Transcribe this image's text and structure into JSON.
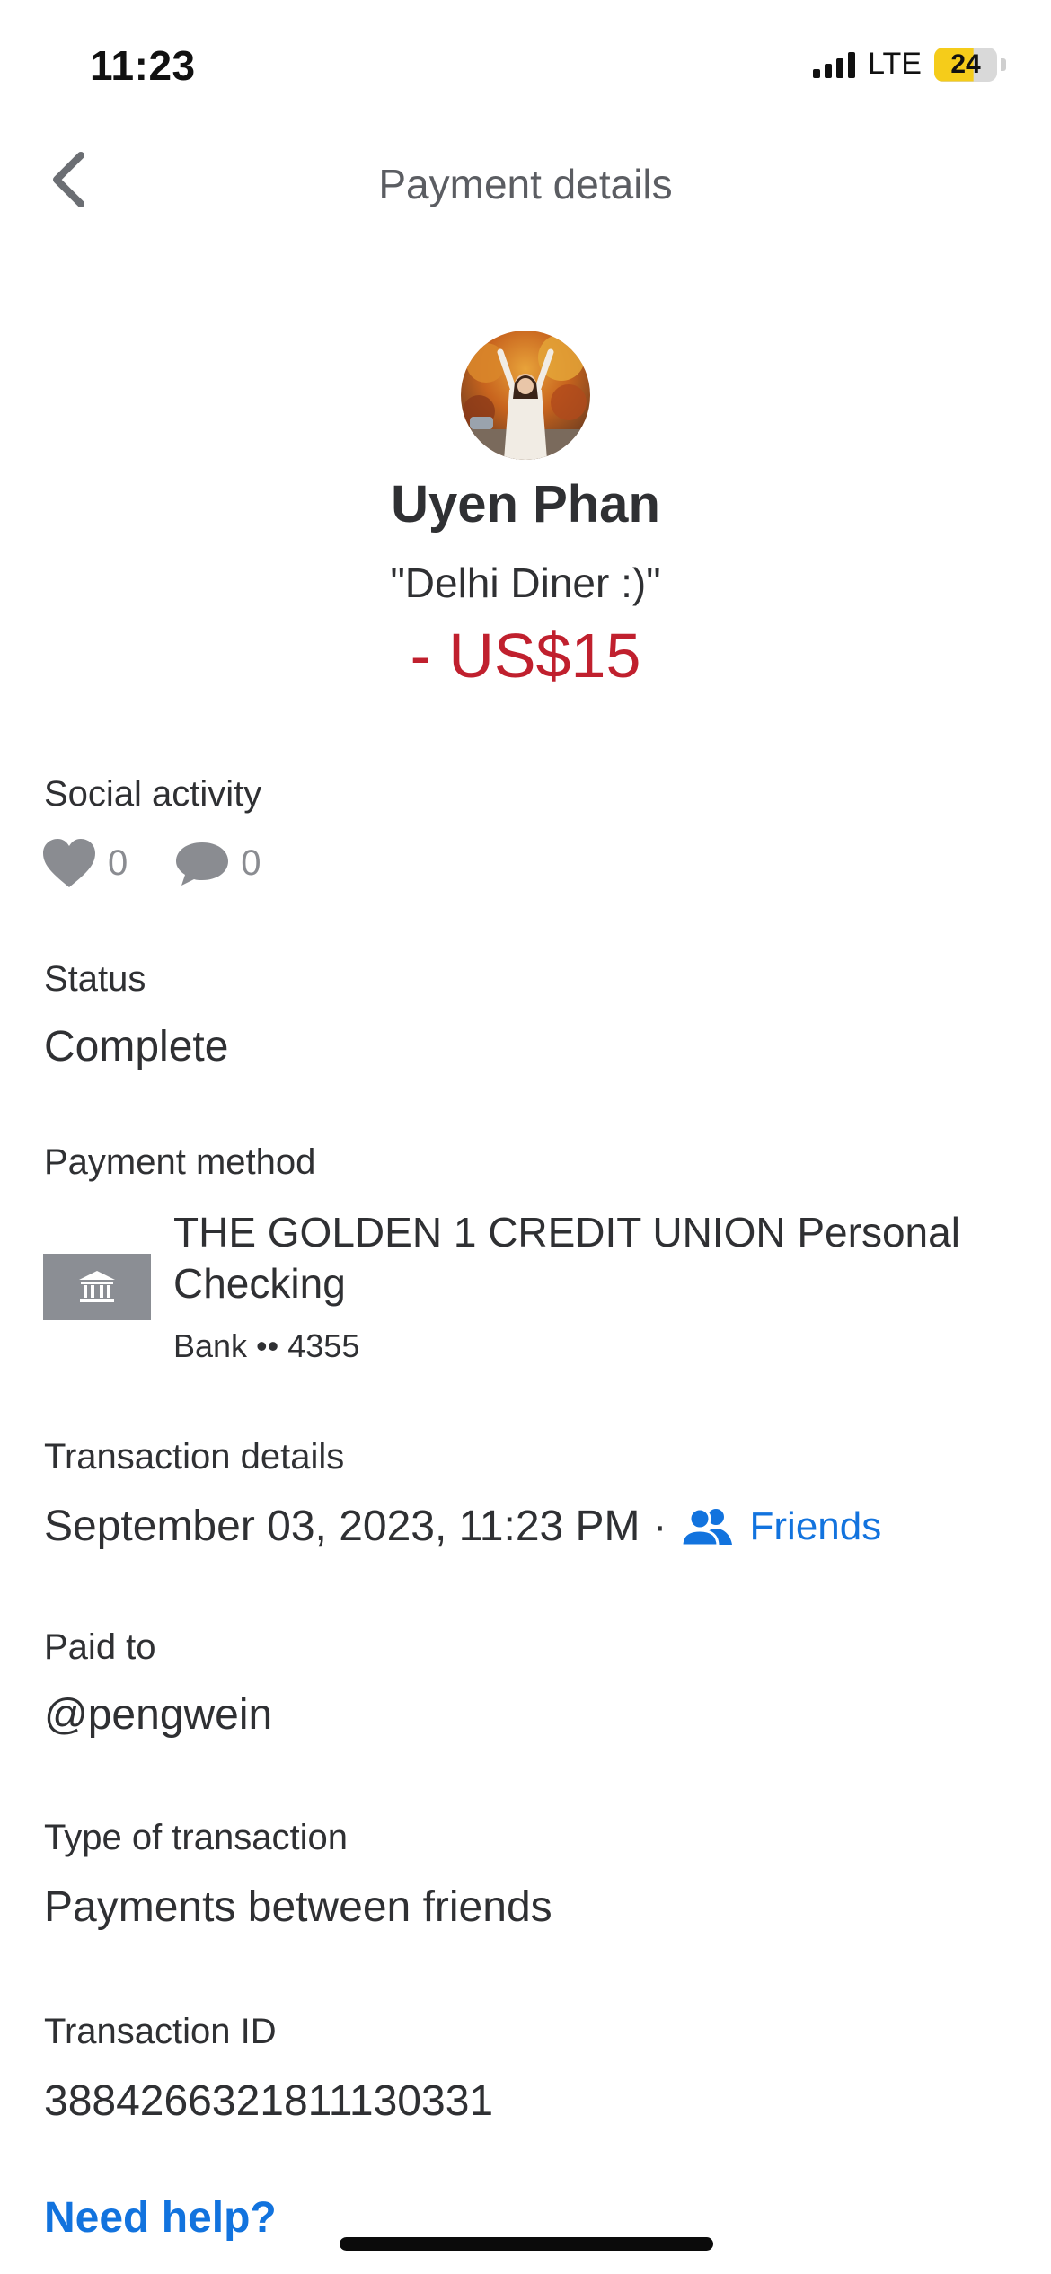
{
  "status_bar": {
    "time": "11:23",
    "network": "LTE",
    "battery": "24",
    "battery_level_percent": 24,
    "battery_color": "#f5cc1a"
  },
  "header": {
    "back_icon": "chevron-left-icon",
    "title": "Payment details"
  },
  "profile": {
    "name": "Uyen Phan",
    "note": "\"Delhi Diner :)\"",
    "amount": "- US$15",
    "amount_color": "#c0202e"
  },
  "social": {
    "label": "Social activity",
    "likes": "0",
    "comments": "0",
    "like_icon": "heart-icon",
    "comment_icon": "comment-bubble-icon"
  },
  "status": {
    "label": "Status",
    "value": "Complete"
  },
  "payment_method": {
    "label": "Payment method",
    "icon": "bank-icon",
    "bank_name": "THE GOLDEN 1 CREDIT UNION Personal Checking",
    "account": "Bank •• 4355"
  },
  "transaction_details": {
    "label": "Transaction details",
    "datetime": "September 03, 2023, 11:23 PM",
    "separator": "·",
    "audience_icon": "friends-icon",
    "audience": "Friends",
    "link_color": "#1273de"
  },
  "paid_to": {
    "label": "Paid to",
    "value": "@pengwein"
  },
  "transaction_type": {
    "label": "Type of transaction",
    "value": "Payments between friends"
  },
  "transaction_id": {
    "label": "Transaction ID",
    "value": "3884266321811130331"
  },
  "help": {
    "label": "Need help?"
  }
}
